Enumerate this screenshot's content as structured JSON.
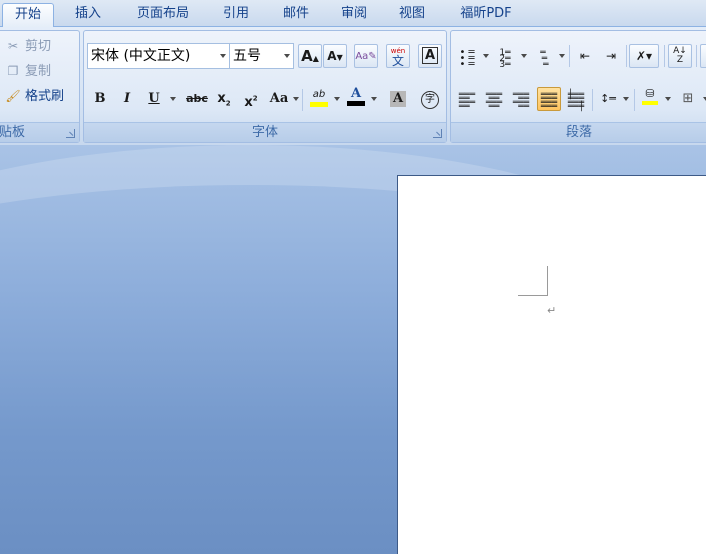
{
  "tabs": [
    {
      "label": "开始",
      "active": true
    },
    {
      "label": "插入"
    },
    {
      "label": "页面布局"
    },
    {
      "label": "引用"
    },
    {
      "label": "邮件"
    },
    {
      "label": "审阅"
    },
    {
      "label": "视图"
    },
    {
      "label": "福昕PDF"
    }
  ],
  "clipboard": {
    "cut": "剪切",
    "copy": "复制",
    "format_painter": "格式刷",
    "label": "贴板"
  },
  "font": {
    "name": "宋体 (中文正文)",
    "size": "五号",
    "label": "字体",
    "grow_text": "A",
    "shrink_text": "A",
    "phonetic_text": "wén",
    "phonetic_char": "文",
    "border_char": "A",
    "bold": "B",
    "italic": "I",
    "underline": "U",
    "strike": "abc",
    "subscript": "x",
    "subscript_mark": "2",
    "superscript": "x",
    "superscript_mark": "2",
    "change_case": "Aa",
    "highlight": "ab",
    "font_color": "A",
    "shading_char": "A",
    "enclose_char": "字"
  },
  "paragraph": {
    "label": "段落"
  },
  "colors": {
    "accent": "#15428b",
    "highlight": "#ffff00",
    "font_color": "#000000"
  }
}
